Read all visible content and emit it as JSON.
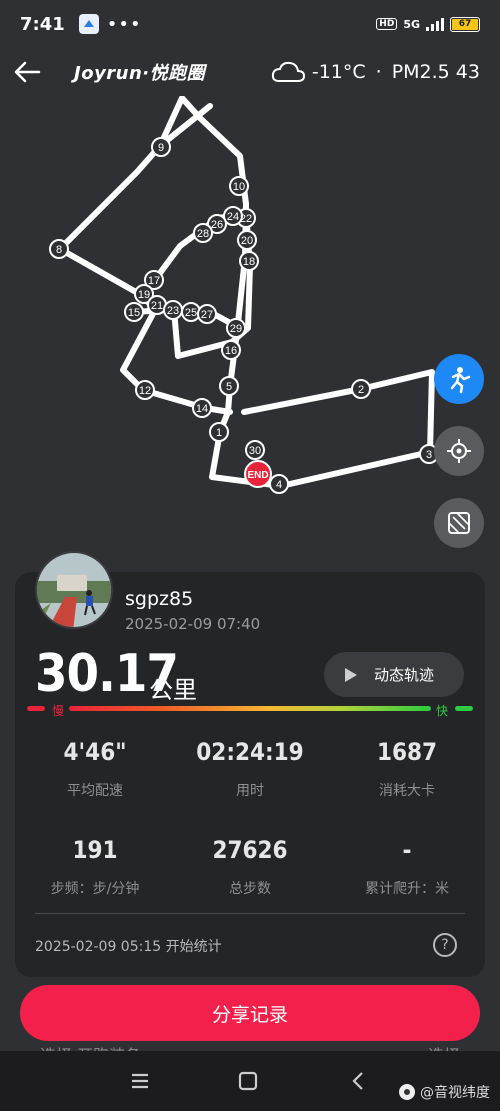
{
  "status_bar": {
    "time": "7:41",
    "dots": "•••",
    "hd": "HD",
    "network": "5G",
    "battery": "67"
  },
  "header": {
    "brand": "Joyrun·悦跑圈",
    "temperature": "-11°C",
    "separator": "·",
    "air_quality": "PM2.5 43"
  },
  "map": {
    "end_label": "END",
    "markers": [
      "1",
      "2",
      "3",
      "4",
      "5",
      "8",
      "9",
      "10",
      "12",
      "14",
      "15",
      "16",
      "17",
      "18",
      "19",
      "20",
      "21",
      "22",
      "23",
      "24",
      "25",
      "26",
      "27",
      "28",
      "29",
      "30"
    ]
  },
  "run": {
    "username": "sgpz85",
    "date_time": "2025-02-09 07:40",
    "distance": "30.17",
    "distance_unit": "公里",
    "replay_label": "动态轨迹",
    "pace_slow": "慢",
    "pace_fast": "快",
    "stats": [
      {
        "value": "4'46\"",
        "label": "平均配速"
      },
      {
        "value": "02:24:19",
        "label": "用时"
      },
      {
        "value": "1687",
        "label": "消耗大卡"
      },
      {
        "value": "191",
        "label": "步频：步/分钟"
      },
      {
        "value": "27626",
        "label": "总步数"
      },
      {
        "value": "-",
        "label": "累计爬升：米"
      }
    ],
    "start_text": "2025-02-09 05:15  开始统计",
    "help": "?"
  },
  "share_label": "分享记录",
  "peek": {
    "left": "选择  开跑装备",
    "right": "选择"
  },
  "watermark": "@音视纬度",
  "colors": {
    "accent": "#f2204a",
    "fab_blue": "#1e88f5"
  }
}
